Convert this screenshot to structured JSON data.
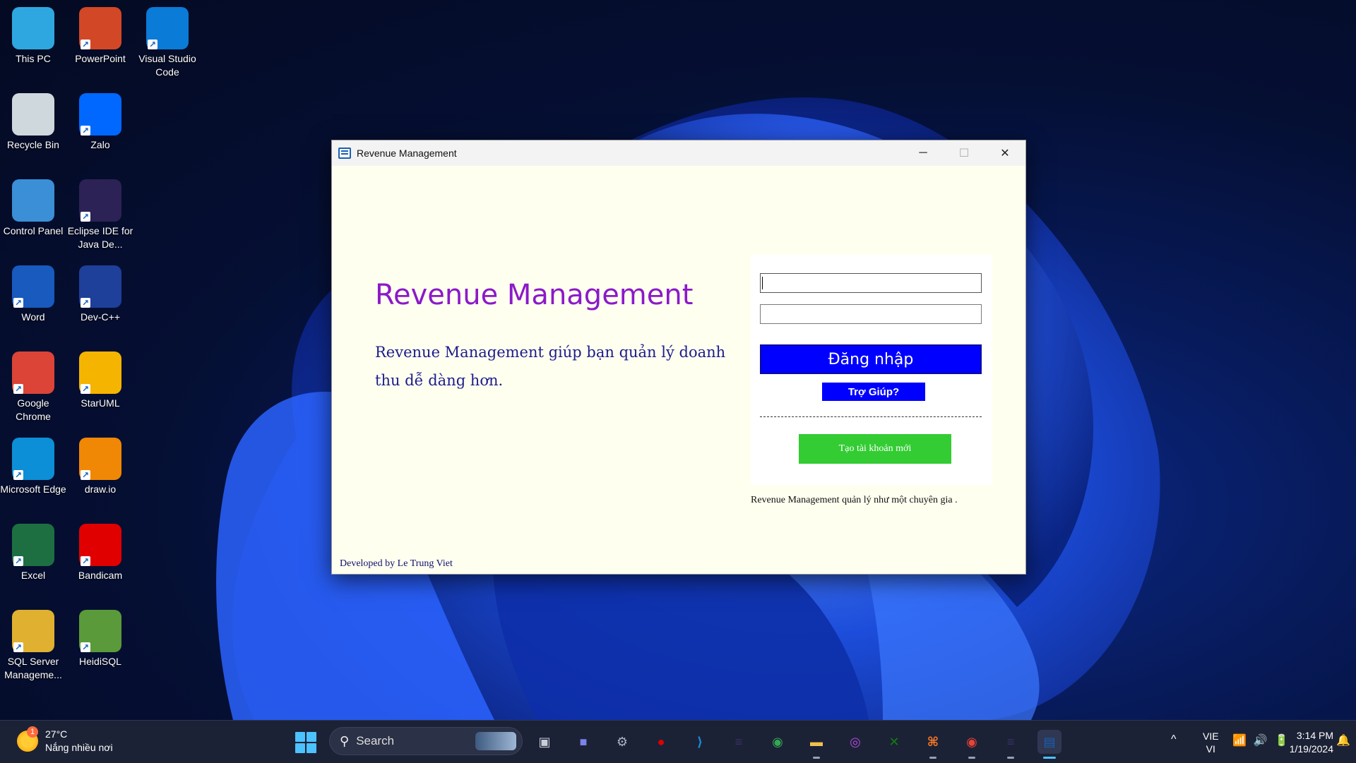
{
  "desktop": {
    "icons": [
      {
        "label": "This PC",
        "icon": "monitor-icon",
        "color": "#2ea7e0"
      },
      {
        "label": "PowerPoint",
        "icon": "powerpoint-icon",
        "color": "#d24726"
      },
      {
        "label": "Visual Studio Code",
        "icon": "vscode-icon",
        "color": "#0a7bd6"
      },
      {
        "label": "Recycle Bin",
        "icon": "recycle-bin-icon",
        "color": "#cfd8dc"
      },
      {
        "label": "Zalo",
        "icon": "zalo-icon",
        "color": "#0068ff"
      },
      {
        "label": "Control Panel",
        "icon": "control-panel-icon",
        "color": "#3a8fd6"
      },
      {
        "label": "Eclipse IDE for Java De...",
        "icon": "eclipse-icon",
        "color": "#2c2255"
      },
      {
        "label": "Word",
        "icon": "word-icon",
        "color": "#185abd"
      },
      {
        "label": "Dev-C++",
        "icon": "devcpp-icon",
        "color": "#1e3f9a"
      },
      {
        "label": "Google Chrome",
        "icon": "chrome-icon",
        "color": "#db4437"
      },
      {
        "label": "StarUML",
        "icon": "staruml-icon",
        "color": "#f4b400"
      },
      {
        "label": "Microsoft Edge",
        "icon": "edge-icon",
        "color": "#0c8fd6"
      },
      {
        "label": "draw.io",
        "icon": "drawio-icon",
        "color": "#f08705"
      },
      {
        "label": "Excel",
        "icon": "excel-icon",
        "color": "#1d6f42"
      },
      {
        "label": "Bandicam",
        "icon": "bandicam-icon",
        "color": "#e00000"
      },
      {
        "label": "SQL Server Manageme...",
        "icon": "sql-server-icon",
        "color": "#e0b030"
      },
      {
        "label": "HeidiSQL",
        "icon": "heidisql-icon",
        "color": "#5a9a3a"
      }
    ]
  },
  "window": {
    "title": "Revenue Management",
    "minimize_glyph": "─",
    "maximize_glyph": "☐",
    "close_glyph": "✕",
    "app_title": "Revenue Management",
    "app_description": "Revenue Management giúp bạn quản lý doanh thu dễ dàng hơn.",
    "username_value": "",
    "password_value": "",
    "login_label": "Đăng nhập",
    "help_label": "Trợ Giúp?",
    "create_account_label": "Tạo tài khoản mới",
    "tagline": "Revenue Management quản lý như một chuyên gia .",
    "footer": "Developed by Le Trung Viet",
    "colors": {
      "title": "#8b19c9",
      "primary_button": "#0000ff",
      "create_button": "#33cc33",
      "background": "#fffff0"
    }
  },
  "taskbar": {
    "weather_temp": "27°C",
    "weather_desc": "Nắng nhiều nơi",
    "weather_badge": "1",
    "search_label": "Search",
    "apps": [
      {
        "name": "task-view",
        "glyph": "▣",
        "color": "#c9ced8"
      },
      {
        "name": "teams-meet",
        "glyph": "■",
        "color": "#7b83eb"
      },
      {
        "name": "settings",
        "glyph": "⚙",
        "color": "#aab4c8"
      },
      {
        "name": "bandicam",
        "glyph": "●",
        "color": "#e00000"
      },
      {
        "name": "vscode",
        "glyph": "⟩",
        "color": "#1a8ad6"
      },
      {
        "name": "eclipse",
        "glyph": "≡",
        "color": "#3b2f6b"
      },
      {
        "name": "chrome",
        "glyph": "◉",
        "color": "#34a853"
      },
      {
        "name": "file-explorer",
        "glyph": "▬",
        "color": "#f2c14e"
      },
      {
        "name": "podcast-app",
        "glyph": "◎",
        "color": "#b04adf"
      },
      {
        "name": "xbox",
        "glyph": "✕",
        "color": "#107c10"
      },
      {
        "name": "xampp",
        "glyph": "⌘",
        "color": "#fb7a24"
      },
      {
        "name": "chrome-profile",
        "glyph": "◉",
        "color": "#ea4335"
      },
      {
        "name": "eclipse-2",
        "glyph": "≡",
        "color": "#3b2f6b"
      },
      {
        "name": "revenue-management",
        "glyph": "▤",
        "color": "#1a5fb4"
      }
    ],
    "tray_chevron": "^",
    "lang_top": "VIE",
    "lang_bottom": "VI",
    "tray_icons": "📶🔊🔋",
    "time": "3:14 PM",
    "date": "1/19/2024",
    "bell": "🔔"
  }
}
